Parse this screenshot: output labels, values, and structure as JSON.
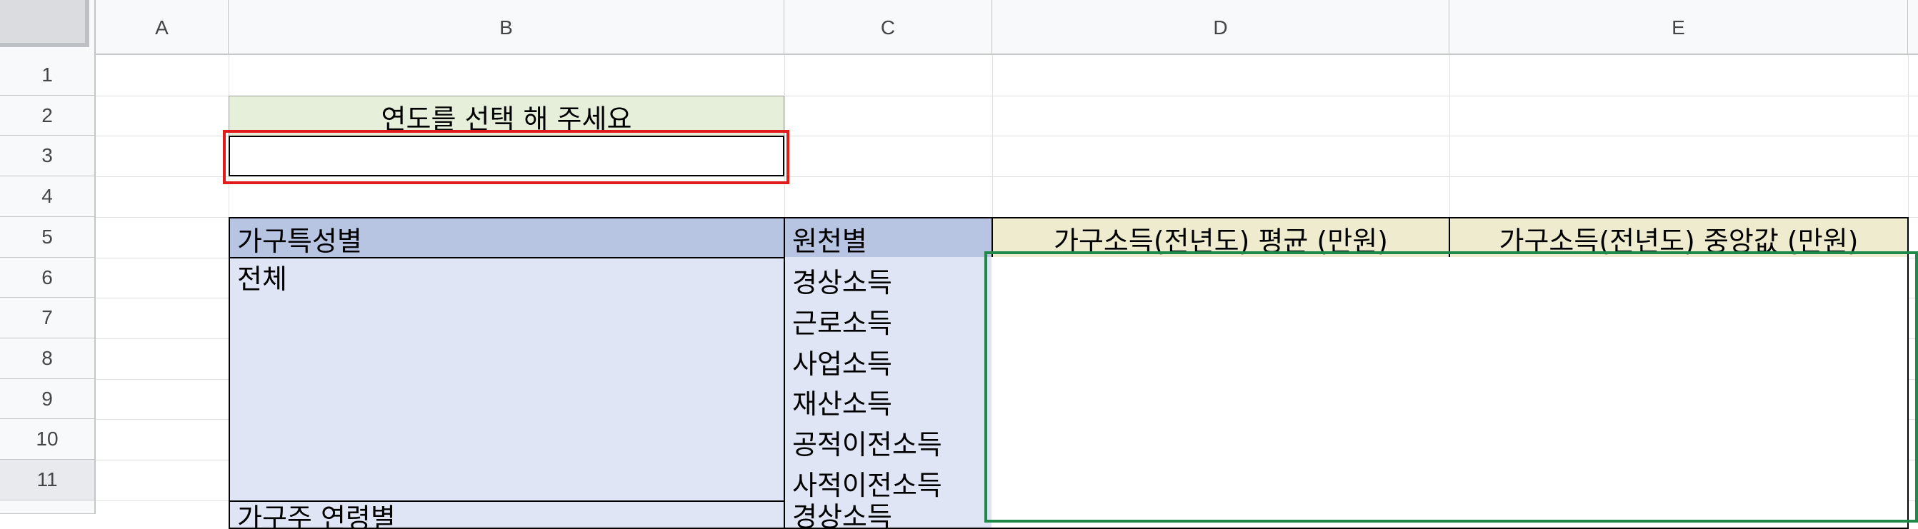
{
  "columns": [
    "A",
    "B",
    "C",
    "D",
    "E"
  ],
  "rows": [
    "1",
    "2",
    "3",
    "4",
    "5",
    "6",
    "7",
    "8",
    "9",
    "10",
    "11"
  ],
  "sheet": {
    "year_prompt": "연도를 선택 해 주세요",
    "year_value": "",
    "header_group": "가구특성별",
    "header_source": "원천별",
    "header_mean": "가구소득(전년도) 평균 (만원)",
    "header_median": "가구소득(전년도) 중앙값 (만원)",
    "group_total": "전체",
    "group_next_partial": "가구주 연령별",
    "sources": [
      "경상소득",
      "근로소득",
      "사업소득",
      "재산소득",
      "공적이전소득",
      "사적이전소득"
    ],
    "source_next_partial": "경상소득"
  },
  "colors": {
    "selection_red": "#e01b1b",
    "selection_green": "#1e8a4a",
    "header_blue": "#b7c4e2",
    "header_yellow": "#efebce",
    "title_green": "#e5efd9"
  }
}
